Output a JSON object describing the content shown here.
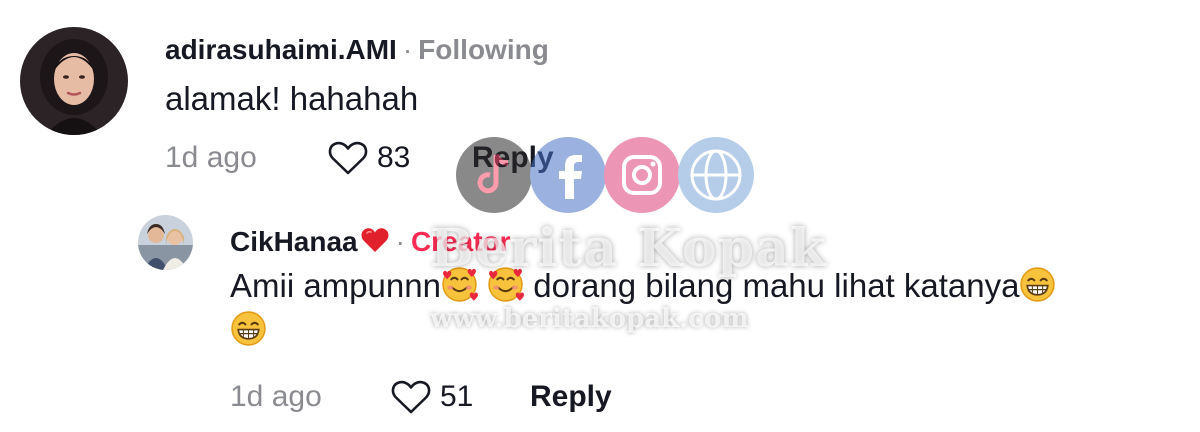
{
  "comments": [
    {
      "username": "adirasuhaimi.AMI",
      "separator": "·",
      "tag": "Following",
      "text": "alamak! hahahah",
      "time": "1d ago",
      "likes": "83",
      "reply_label": "Reply"
    },
    {
      "username": "CikHanaa",
      "username_badge": "red-heart-icon",
      "separator": "·",
      "tag": "Creator",
      "text_parts": [
        "Amii ampunnn",
        " dorang bilang mahu lihat katanya"
      ],
      "emojis": [
        "smiling-face-with-hearts",
        "smiling-face-with-hearts",
        "grinning-face",
        "grinning-face"
      ],
      "time": "1d ago",
      "likes": "51",
      "reply_label": "Reply"
    }
  ],
  "watermark": {
    "title": "Berita Kopak",
    "url": "www.beritakopak.com",
    "icons": [
      "tiktok-icon",
      "facebook-icon",
      "instagram-icon",
      "globe-icon"
    ]
  },
  "colors": {
    "primary_text": "#161823",
    "secondary_text": "#8a8b91",
    "creator_accent": "#fe2c55",
    "heart_badge": "#e0202a"
  }
}
